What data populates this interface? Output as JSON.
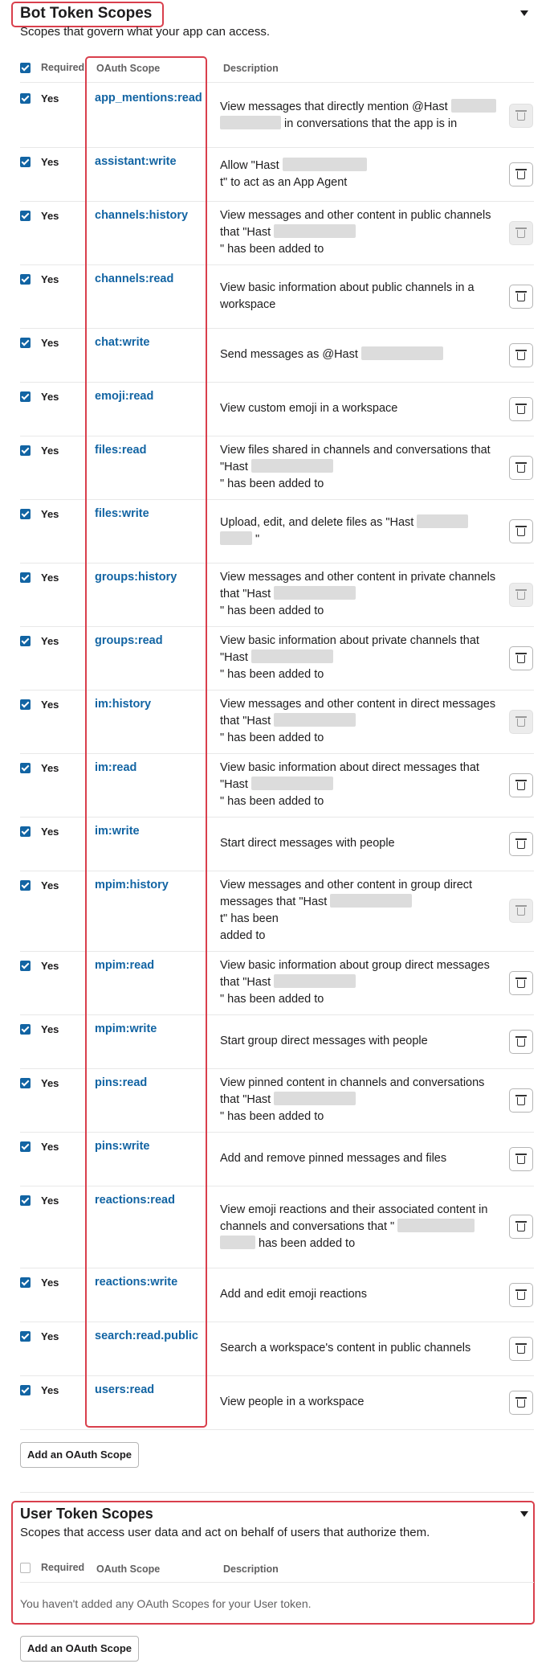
{
  "bot_section": {
    "title": "Bot Token Scopes",
    "subtitle": "Scopes that govern what your app can access.",
    "headers": {
      "required": "Required",
      "scope": "OAuth Scope",
      "description": "Description"
    },
    "add_button": "Add an OAuth Scope",
    "rows": [
      {
        "required": "Yes",
        "scope": "app_mentions:read",
        "lines": [
          "View messages that directly mention @Hast",
          "in conversations that the app is in"
        ],
        "delete_enabled": false
      },
      {
        "required": "Yes",
        "scope": "assistant:write",
        "lines": [
          "Allow \"Hast",
          "t\" to act as an App Agent"
        ],
        "delete_enabled": true
      },
      {
        "required": "Yes",
        "scope": "channels:history",
        "lines": [
          "View messages and other content in public channels",
          "that \"Hast",
          "\" has been added to"
        ],
        "delete_enabled": false
      },
      {
        "required": "Yes",
        "scope": "channels:read",
        "lines": [
          "View basic information about public channels in a",
          "workspace"
        ],
        "delete_enabled": true
      },
      {
        "required": "Yes",
        "scope": "chat:write",
        "lines": [
          "Send messages as @Hast"
        ],
        "delete_enabled": true
      },
      {
        "required": "Yes",
        "scope": "emoji:read",
        "lines": [
          "View custom emoji in a workspace"
        ],
        "delete_enabled": true
      },
      {
        "required": "Yes",
        "scope": "files:read",
        "lines": [
          "View files shared in channels and conversations that",
          "\"Hast",
          "\" has been added to"
        ],
        "delete_enabled": true
      },
      {
        "required": "Yes",
        "scope": "files:write",
        "lines": [
          "Upload, edit, and delete files as \"Hast",
          "\""
        ],
        "delete_enabled": true
      },
      {
        "required": "Yes",
        "scope": "groups:history",
        "lines": [
          "View messages and other content in private channels",
          "that \"Hast",
          "\" has been added to"
        ],
        "delete_enabled": false
      },
      {
        "required": "Yes",
        "scope": "groups:read",
        "lines": [
          "View basic information about private channels that",
          "\"Hast",
          "\" has been added to"
        ],
        "delete_enabled": true
      },
      {
        "required": "Yes",
        "scope": "im:history",
        "lines": [
          "View messages and other content in direct messages",
          "that \"Hast",
          "\" has been added to"
        ],
        "delete_enabled": false
      },
      {
        "required": "Yes",
        "scope": "im:read",
        "lines": [
          "View basic information about direct messages that",
          "\"Hast",
          "\" has been added to"
        ],
        "delete_enabled": true
      },
      {
        "required": "Yes",
        "scope": "im:write",
        "lines": [
          "Start direct messages with people"
        ],
        "delete_enabled": true
      },
      {
        "required": "Yes",
        "scope": "mpim:history",
        "lines": [
          "View messages and other content in group direct",
          "messages that \"Hast",
          "t\" has been",
          "added to"
        ],
        "delete_enabled": false
      },
      {
        "required": "Yes",
        "scope": "mpim:read",
        "lines": [
          "View basic information about group direct messages",
          "that \"Hast",
          "\" has been added to"
        ],
        "delete_enabled": true
      },
      {
        "required": "Yes",
        "scope": "mpim:write",
        "lines": [
          "Start group direct messages with people"
        ],
        "delete_enabled": true
      },
      {
        "required": "Yes",
        "scope": "pins:read",
        "lines": [
          "View pinned content in channels and conversations",
          "that \"Hast",
          "\" has been added to"
        ],
        "delete_enabled": true
      },
      {
        "required": "Yes",
        "scope": "pins:write",
        "lines": [
          "Add and remove pinned messages and files"
        ],
        "delete_enabled": true
      },
      {
        "required": "Yes",
        "scope": "reactions:read",
        "lines": [
          "View emoji reactions and their associated content in",
          "channels and conversations that \"",
          "has been added to"
        ],
        "delete_enabled": true
      },
      {
        "required": "Yes",
        "scope": "reactions:write",
        "lines": [
          "Add and edit emoji reactions"
        ],
        "delete_enabled": true
      },
      {
        "required": "Yes",
        "scope": "search:read.public",
        "lines": [
          "Search a workspace's content in public channels"
        ],
        "delete_enabled": true
      },
      {
        "required": "Yes",
        "scope": "users:read",
        "lines": [
          "View people in a workspace"
        ],
        "delete_enabled": true
      }
    ]
  },
  "user_section": {
    "title": "User Token Scopes",
    "subtitle": "Scopes that access user data and act on behalf of users that authorize them.",
    "headers": {
      "required": "Required",
      "scope": "OAuth Scope",
      "description": "Description"
    },
    "empty_message": "You haven't added any OAuth Scopes for your User token.",
    "add_button": "Add an OAuth Scope"
  },
  "icons": {
    "collapse": "caret-down-icon",
    "delete": "trash-icon",
    "checkbox": "checkbox-icon"
  },
  "colors": {
    "link": "#1264a3",
    "highlight": "#d93f4c",
    "checkbox": "#1264a3"
  }
}
